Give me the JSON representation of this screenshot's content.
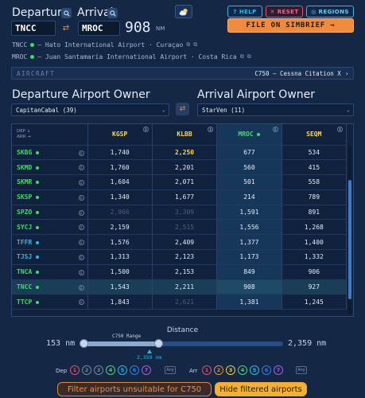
{
  "top": {
    "departure_label": "Departure",
    "arrival_label": "Arrival",
    "departure_code": "TNCC",
    "arrival_code": "MROC",
    "distance_value": "908",
    "distance_unit": "NM",
    "help_label": "HELP",
    "reset_label": "RESET",
    "regions_label": "REGIONS",
    "simbrief_label": "FILE ON SIMBRIEF →"
  },
  "airports": {
    "dep_code": "TNCC",
    "dep_name": "— Hato International Airport · Curaçao",
    "arr_code": "MROC",
    "arr_name": "— Juan Santamaría International Airport · Costa Rica"
  },
  "aircraft": {
    "label": "AIRCRAFT",
    "value": "C750 — Cessna Citation X"
  },
  "owners": {
    "dep_title": "Departure Airport Owner",
    "arr_title": "Arrival Airport Owner",
    "dep_selected": "CapitanCabal (39)",
    "arr_selected": "StarVen (11)"
  },
  "table": {
    "corner_top": "DEP ↓",
    "corner_bottom": "ARR →",
    "columns": [
      {
        "code": "KGSP",
        "color": "#ffd84a"
      },
      {
        "code": "KLBB",
        "color": "#ffd84a"
      },
      {
        "code": "MROC",
        "color": "#3ddc6a"
      },
      {
        "code": "SEQM",
        "color": "#ffd84a"
      }
    ],
    "rows": [
      {
        "code": "SKBG",
        "dot": "#3ddc6a",
        "cells": [
          "1,740",
          "2,250",
          "677",
          "534"
        ]
      },
      {
        "code": "SKMD",
        "dot": "#3ddc6a",
        "cells": [
          "1,760",
          "2,201",
          "560",
          "415"
        ]
      },
      {
        "code": "SKMR",
        "dot": "#3ddc6a",
        "cells": [
          "1,604",
          "2,071",
          "501",
          "558"
        ]
      },
      {
        "code": "SKSP",
        "dot": "#3ddc6a",
        "cells": [
          "1,340",
          "1,677",
          "214",
          "789"
        ]
      },
      {
        "code": "SPZO",
        "dot": "#3ddc6a",
        "cells": [
          "2,966",
          "3,309",
          "1,591",
          "891"
        ]
      },
      {
        "code": "SYCJ",
        "dot": "#3ddc6a",
        "cells": [
          "2,159",
          "2,515",
          "1,556",
          "1,268"
        ]
      },
      {
        "code": "TFFR",
        "dot": "#2fb7e6",
        "cells": [
          "1,576",
          "2,409",
          "1,377",
          "1,400"
        ]
      },
      {
        "code": "TJSJ",
        "dot": "#2fb7e6",
        "cells": [
          "1,313",
          "2,123",
          "1,173",
          "1,332"
        ]
      },
      {
        "code": "TNCA",
        "dot": "#3ddc6a",
        "cells": [
          "1,500",
          "2,153",
          "849",
          "906"
        ]
      },
      {
        "code": "TNCC",
        "dot": "#3ddc6a",
        "cells": [
          "1,543",
          "2,211",
          "908",
          "927"
        ]
      },
      {
        "code": "TTCP",
        "dot": "#3ddc6a",
        "cells": [
          "1,843",
          "2,621",
          "1,381",
          "1,245"
        ]
      }
    ]
  },
  "distance": {
    "title": "Distance",
    "min": "153 nm",
    "max": "2,359 nm",
    "range_label": "C750 Range",
    "range_value": "2,359 nm",
    "range_fraction": 0.38
  },
  "runways": {
    "dep_label": "Dep",
    "arr_label": "Arr",
    "any_label": "Any",
    "chips": [
      {
        "n": "1",
        "color": "#e0506a"
      },
      {
        "n": "2",
        "color": "#7a8699"
      },
      {
        "n": "3",
        "color": "#7a8699"
      },
      {
        "n": "4",
        "color": "#3ddc6a"
      },
      {
        "n": "5",
        "color": "#2fb7e6"
      },
      {
        "n": "6",
        "color": "#2f7fe6"
      },
      {
        "n": "7",
        "color": "#b05ae0"
      }
    ],
    "arr_chips": [
      {
        "n": "1",
        "color": "#e0506a"
      },
      {
        "n": "2",
        "color": "#e08a3a"
      },
      {
        "n": "3",
        "color": "#e6d23a"
      },
      {
        "n": "4",
        "color": "#3ddc6a"
      },
      {
        "n": "5",
        "color": "#2fb7e6"
      },
      {
        "n": "6",
        "color": "#2f7fe6"
      },
      {
        "n": "7",
        "color": "#b05ae0"
      }
    ]
  },
  "filters": {
    "unsuitable_label": "Filter airports unsuitable for C750",
    "hide_label": "Hide filtered airports"
  }
}
